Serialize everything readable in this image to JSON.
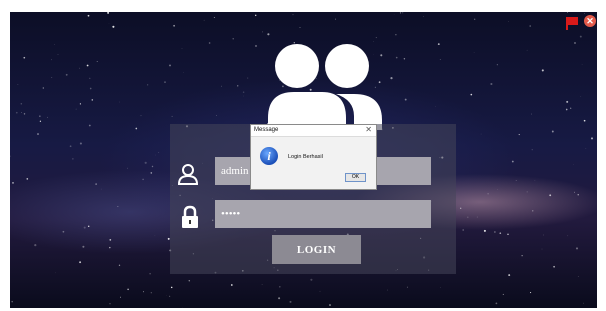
{
  "window": {
    "controls": [
      "flag-icon",
      "close-icon"
    ],
    "close_glyph": "✕"
  },
  "login_form": {
    "username_value": "admin",
    "password_value": "•••••",
    "login_label": "LOGIN",
    "user_icon": "user-icon",
    "lock_icon": "lock-icon"
  },
  "dialog": {
    "title": "Message",
    "close_glyph": "✕",
    "icon": "info-icon",
    "icon_glyph": "i",
    "message": "Login Berhasil",
    "ok_label": "OK"
  },
  "colors": {
    "background": "#171a44",
    "field": "#a7a5ae",
    "button": "#8c8a93",
    "flag": "#d91a1a",
    "close": "#e35a4a"
  }
}
